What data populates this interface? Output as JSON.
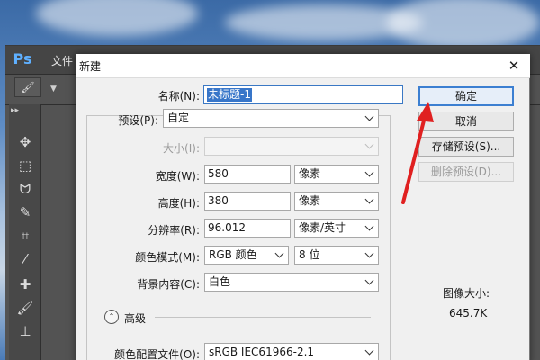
{
  "app": {
    "logo": "Ps",
    "menu_file": "文件",
    "tool_icons": [
      "move-icon",
      "marquee-icon",
      "lasso-icon",
      "quick-select-icon",
      "crop-icon",
      "eyedropper-icon",
      "healing-icon",
      "brush-icon",
      "stamp-icon"
    ]
  },
  "dialog": {
    "title": "新建",
    "close_glyph": "✕",
    "name_label": "名称(N):",
    "name_value": "未标题-1",
    "preset_label": "预设(P):",
    "preset_value": "自定",
    "size_label": "大小(I):",
    "size_value": "",
    "width_label": "宽度(W):",
    "width_value": "580",
    "width_unit": "像素",
    "height_label": "高度(H):",
    "height_value": "380",
    "height_unit": "像素",
    "resolution_label": "分辨率(R):",
    "resolution_value": "96.012",
    "resolution_unit": "像素/英寸",
    "color_mode_label": "颜色模式(M):",
    "color_mode_value": "RGB 颜色",
    "bit_depth_value": "8 位",
    "background_label": "背景内容(C):",
    "background_value": "白色",
    "advanced_label": "高级",
    "advanced_glyph": "⌃",
    "profile_label": "颜色配置文件(O):",
    "profile_value": "sRGB IEC61966-2.1",
    "image_size_label": "图像大小:",
    "image_size_value": "645.7K",
    "ok_label": "确定",
    "cancel_label": "取消",
    "save_preset_label": "存储预设(S)...",
    "delete_preset_label": "删除预设(D)..."
  },
  "colors": {
    "accent": "#3c7fd1",
    "arrow": "#e02020"
  }
}
